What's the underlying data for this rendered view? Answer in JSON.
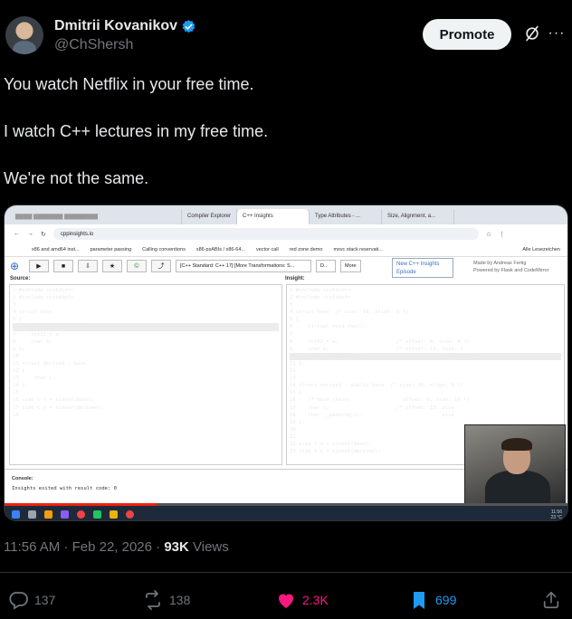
{
  "author": {
    "name": "Dmitrii Kovanikov",
    "handle": "@ChShersh",
    "verified": true
  },
  "header": {
    "promote_label": "Promote"
  },
  "tweet": {
    "lines": [
      "You watch Netflix in your free time.",
      "I watch C++ lectures in my free time.",
      "We're not the same."
    ]
  },
  "screenshot": {
    "tabs": [
      "Compiler Explorer",
      "C++ Insights",
      "Type Attributes - ...",
      "Size, Alignment, a..."
    ],
    "url": "cppinsights.io",
    "bookmarks": [
      "x86 and amd64 inst...",
      "parameter passing",
      "Calling conventions",
      "x86-psABIs / x86-64...",
      "vector call",
      "red zone demo",
      "msvc stack reservati...",
      "Alle Lesezeichen"
    ],
    "standard_select": "[C++ Standard: C++ 17] [More Transformations: S...",
    "more_label": "More",
    "episode_popup": [
      "New C++ Insights",
      "Episode"
    ],
    "made_by": [
      "Made by Andreas Fertig",
      "Powered by Flask and CodeMirror"
    ],
    "source_label": "Source:",
    "insight_label": "Insight:",
    "source_lines": [
      "1 #include <cstdint>",
      "2 #include <cstddef>",
      "3",
      "4 struct base",
      "5 {",
      "6     virtual void foo();",
      "7     int32_t a;",
      "8     char b;",
      "9 };",
      "10",
      "11 struct derived : base",
      "12 {",
      "13     char c;",
      "14 };",
      "15",
      "16 size_t x = sizeof(base);",
      "17 size_t y = sizeof(derived);",
      "18"
    ],
    "insight_lines": [
      "1 #include <cstdint>",
      "2 #include <cstddef>",
      "3",
      "4 struct base  /* size: 16, align: 8 */",
      "5 {",
      "6     virtual void foo();",
      "7",
      "8     int32_t a;                   /* offset: 8, size: 4 */",
      "9     char b;                      /* offset: 12, size: 1",
      "10    char __padding[3];                          size: 3 */",
      "11 };",
      "12",
      "13",
      "14 struct derived : public base  /* size: 16, align: 8 */",
      "15 {",
      "16    /* base (base)                 offset: 0, size: 16 */",
      "17    char c;                      /* offset: 13, size",
      "18    char __padding[2];                          size",
      "19 };",
      "20",
      "21",
      "22 size_t x = sizeof(base);",
      "23 size_t y = sizeof(derived);"
    ],
    "console_label": "Console:",
    "console_output": "Insights exited with result code: 0",
    "video_progress": 0.27,
    "tray_time": "11:56",
    "tray_temp": "23 °C"
  },
  "meta": {
    "time": "11:56 AM · Feb 22, 2026 · ",
    "views_count": "93K",
    "views_label": " Views"
  },
  "actions": {
    "replies": "137",
    "reposts": "138",
    "likes": "2.3K",
    "bookmarks": "699"
  },
  "colors": {
    "background": "#000000",
    "text": "#e7e9ea",
    "muted": "#71767b",
    "verified": "#1d9bf0",
    "like": "#f91880",
    "bookmark": "#1d9bf0"
  },
  "icons": [
    "verified-badge-icon",
    "grok-slash-icon",
    "more-dots-icon",
    "reply-icon",
    "repost-icon",
    "like-heart-icon",
    "bookmark-icon",
    "share-icon"
  ]
}
